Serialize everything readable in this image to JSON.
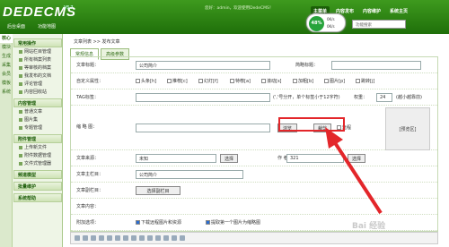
{
  "brand": {
    "logo": "DEDECMS",
    "version": "V5.7"
  },
  "top": {
    "info": "您好：admin，欢迎使用DedeCMS！",
    "nav": [
      "主菜单",
      "内容发布",
      "内容维护",
      "系统主页"
    ],
    "sublinks": [
      "后台桌面",
      "功能地图"
    ],
    "search_placeholder": "功能搜索"
  },
  "badge": {
    "percent": "48%",
    "up": "0K/s",
    "down": "0K/s"
  },
  "side": {
    "vtabs": [
      "核心",
      "模块",
      "生成",
      "采集",
      "会员",
      "模板",
      "系统"
    ],
    "groups": [
      {
        "title": "常用操作",
        "items": [
          "网站栏目管理",
          "所有档案列表",
          "等审核的档案",
          "我发布的文档",
          "评论管理",
          "内容回收站"
        ]
      },
      {
        "title": "内容管理",
        "items": [
          "普通文章",
          "图片集",
          "专题管理"
        ]
      },
      {
        "title": "附件管理",
        "items": [
          "上传新文件",
          "附件数据管理",
          "文件式管理器"
        ]
      },
      {
        "title": "频道模型",
        "items": []
      },
      {
        "title": "批量维护",
        "items": []
      },
      {
        "title": "系统帮助",
        "items": []
      }
    ]
  },
  "main": {
    "crumb": "文章列表 >> 发布文章",
    "tabs": [
      "常规信息",
      "高级参数"
    ],
    "title_label": "文章标题：",
    "title_value": "公司简介",
    "short_title_label": "简略标题：",
    "attr_label": "自定义属性：",
    "attrs": [
      "头条[h]",
      "推荐[c]",
      "幻灯[f]",
      "特荐[a]",
      "滚动[s]",
      "加粗[b]",
      "图片[p]",
      "跳转[j]"
    ],
    "tag_label": "TAG标签：",
    "tag_hint": "(','号分开，单个标签小于12字符)",
    "weight_label": "权重：",
    "weight_value": "24",
    "weight_hint": "(越小越靠前)",
    "thumb_label": "缩 略 图：",
    "browse": "浏览",
    "crop": "裁剪",
    "remote": "远程",
    "thumb_area": "[预览区]",
    "source_label": "文章来源：",
    "source_value": "未知",
    "select_btn": "选择",
    "author_label": "作 者：",
    "author_value": "321",
    "column_label": "文章主栏目：",
    "column_value": "公司简介",
    "sub_column_label": "文章副栏目：",
    "sub_column_btn": "选择副栏目",
    "content_label": "文章内容：",
    "attach_label": "附加选项：",
    "attach1": "下载远程图片和资源",
    "attach2": "提取第一个图片为缩略图"
  },
  "watermark": "Bai 经验"
}
